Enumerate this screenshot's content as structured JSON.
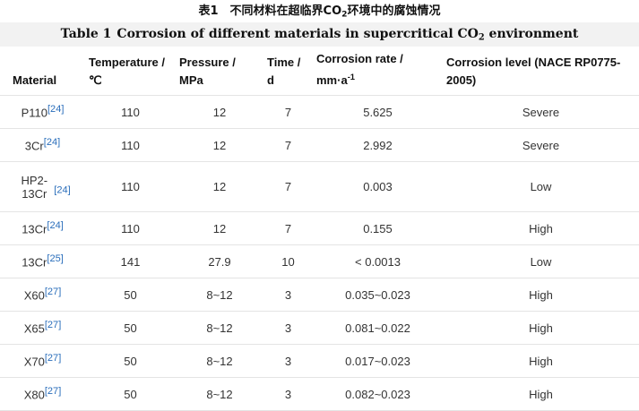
{
  "caption": {
    "zh_prefix": "表1　不同材料在超临界CO",
    "zh_sub": "2",
    "zh_suffix": "环境中的腐蚀情况",
    "en_label": "Table 1",
    "en_prefix": "Corrosion of different materials in supercritical CO",
    "en_sub": "2",
    "en_suffix": " environment"
  },
  "headers": {
    "material": "Material",
    "temperature": "Temperature / ℃",
    "pressure": "Pressure / MPa",
    "time": "Time / d",
    "rate_prefix": "Corrosion rate / mm·a",
    "rate_sup": "-1",
    "level": "Corrosion level (NACE RP0775-2005)"
  },
  "rows": [
    {
      "material": "P110",
      "ref": "[24]",
      "temperature": "110",
      "pressure": "12",
      "time": "7",
      "rate": "5.625",
      "level": "Severe"
    },
    {
      "material": "3Cr",
      "ref": "[24]",
      "temperature": "110",
      "pressure": "12",
      "time": "7",
      "rate": "2.992",
      "level": "Severe"
    },
    {
      "material": "HP2-13Cr",
      "ref": "[24]",
      "temperature": "110",
      "pressure": "12",
      "time": "7",
      "rate": "0.003",
      "level": "Low"
    },
    {
      "material": "13Cr",
      "ref": "[24]",
      "temperature": "110",
      "pressure": "12",
      "time": "7",
      "rate": "0.155",
      "level": "High"
    },
    {
      "material": "13Cr",
      "ref": "[25]",
      "temperature": "141",
      "pressure": "27.9",
      "time": "10",
      "rate": "< 0.0013",
      "level": "Low"
    },
    {
      "material": "X60",
      "ref": "[27]",
      "temperature": "50",
      "pressure": "8~12",
      "time": "3",
      "rate": "0.035~0.023",
      "level": "High"
    },
    {
      "material": "X65",
      "ref": "[27]",
      "temperature": "50",
      "pressure": "8~12",
      "time": "3",
      "rate": "0.081~0.022",
      "level": "High"
    },
    {
      "material": "X70",
      "ref": "[27]",
      "temperature": "50",
      "pressure": "8~12",
      "time": "3",
      "rate": "0.017~0.023",
      "level": "High"
    },
    {
      "material": "X80",
      "ref": "[27]",
      "temperature": "50",
      "pressure": "8~12",
      "time": "3",
      "rate": "0.082~0.023",
      "level": "High"
    }
  ]
}
